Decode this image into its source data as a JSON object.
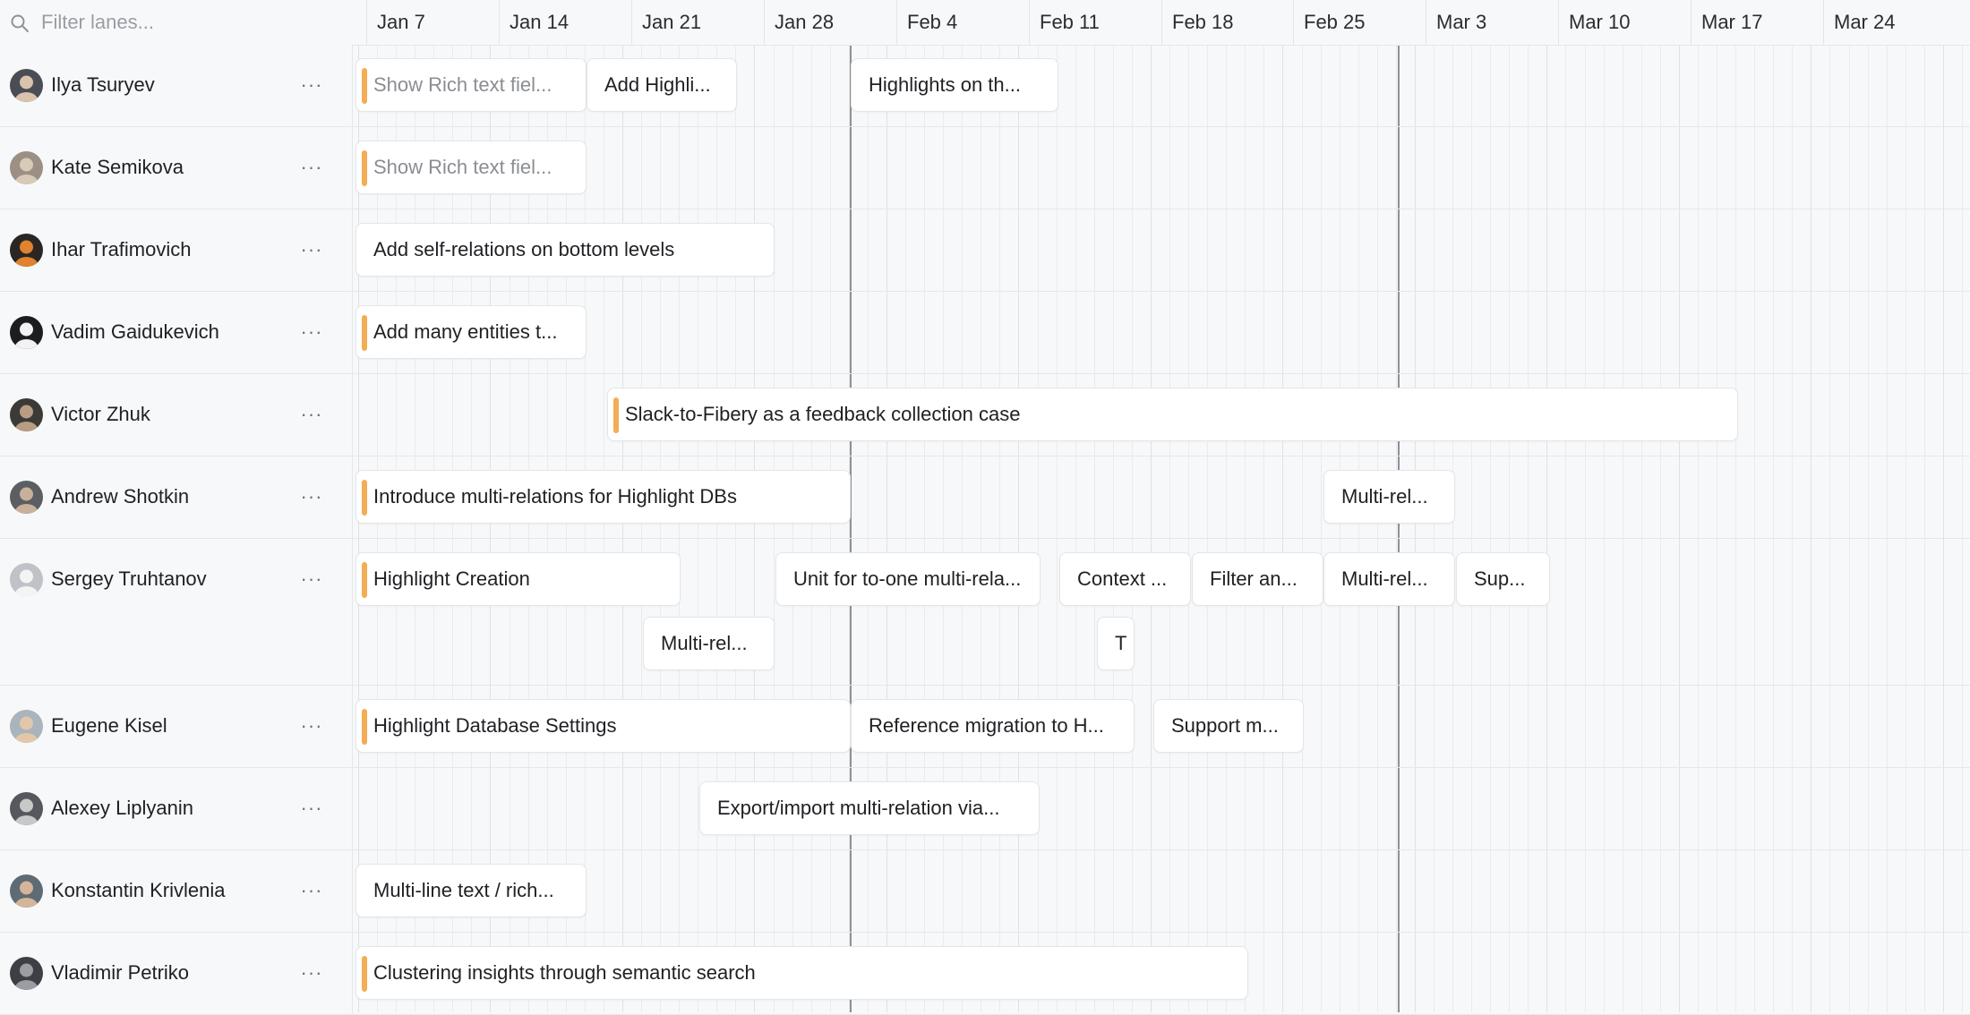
{
  "filter": {
    "placeholder": "Filter lanes..."
  },
  "colors": {
    "accent": "#f3ad54",
    "background": "#f7f8fa",
    "card": "#ffffff",
    "today_marker": "#8e9197"
  },
  "dates": [
    "Jan 7",
    "Jan 14",
    "Jan 21",
    "Jan 28",
    "Feb 4",
    "Feb 11",
    "Feb 18",
    "Feb 25",
    "Mar 3",
    "Mar 10",
    "Mar 17",
    "Mar 24"
  ],
  "lane_menu_label": "···",
  "lanes": [
    {
      "name": "Ilya Tsuryev",
      "avatar": "avatar-ilya",
      "cards": [
        {
          "title": "Show Rich text fiel...",
          "accent": true,
          "dim": true
        },
        {
          "title": "Add Highli...",
          "accent": false,
          "dim": false
        },
        {
          "title": "Highlights on th...",
          "accent": false,
          "dim": false
        }
      ]
    },
    {
      "name": "Kate Semikova",
      "avatar": "avatar-kate",
      "cards": [
        {
          "title": "Show Rich text fiel...",
          "accent": true,
          "dim": true
        }
      ]
    },
    {
      "name": "Ihar Trafimovich",
      "avatar": "avatar-ihar",
      "cards": [
        {
          "title": "Add self-relations on bottom levels",
          "accent": false,
          "dim": false
        }
      ]
    },
    {
      "name": "Vadim Gaidukevich",
      "avatar": "avatar-vadim",
      "cards": [
        {
          "title": "Add many entities t...",
          "accent": true,
          "dim": false
        }
      ]
    },
    {
      "name": "Victor Zhuk",
      "avatar": "avatar-victor",
      "cards": [
        {
          "title": "Slack-to-Fibery as a feedback collection case",
          "accent": true,
          "dim": false
        }
      ]
    },
    {
      "name": "Andrew Shotkin",
      "avatar": "avatar-andrew",
      "cards": [
        {
          "title": "Introduce multi-relations for Highlight DBs",
          "accent": true,
          "dim": false
        },
        {
          "title": "Multi-rel...",
          "accent": false,
          "dim": false
        }
      ]
    },
    {
      "name": "Sergey Truhtanov",
      "avatar": "avatar-sergey",
      "cards": [
        {
          "title": "Highlight Creation",
          "accent": true,
          "dim": false
        },
        {
          "title": "Unit for to-one multi-rela...",
          "accent": false,
          "dim": false
        },
        {
          "title": "Context ...",
          "accent": false,
          "dim": false
        },
        {
          "title": "Filter an...",
          "accent": false,
          "dim": false
        },
        {
          "title": "Multi-rel...",
          "accent": false,
          "dim": false
        },
        {
          "title": "Sup...",
          "accent": false,
          "dim": false
        },
        {
          "title": "Multi-rel...",
          "accent": false,
          "dim": false
        },
        {
          "title": "T.",
          "accent": false,
          "dim": false
        }
      ]
    },
    {
      "name": "Eugene Kisel",
      "avatar": "avatar-eugene",
      "cards": [
        {
          "title": "Highlight Database Settings",
          "accent": true,
          "dim": false
        },
        {
          "title": "Reference migration to H...",
          "accent": false,
          "dim": false
        },
        {
          "title": "Support m...",
          "accent": false,
          "dim": false
        }
      ]
    },
    {
      "name": "Alexey Liplyanin",
      "avatar": "avatar-alexey",
      "cards": [
        {
          "title": "Export/import multi-relation via...",
          "accent": false,
          "dim": false
        }
      ]
    },
    {
      "name": "Konstantin Krivlenia",
      "avatar": "avatar-konstantin",
      "cards": [
        {
          "title": "Multi-line text / rich...",
          "accent": false,
          "dim": false
        }
      ]
    },
    {
      "name": "Vladimir Petriko",
      "avatar": "avatar-vladimir",
      "cards": [
        {
          "title": "Clustering insights through semantic search",
          "accent": true,
          "dim": false
        }
      ]
    }
  ]
}
